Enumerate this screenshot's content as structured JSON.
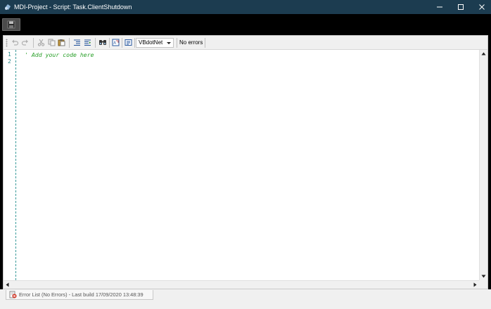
{
  "window": {
    "title": "MDI-Project - Script: Task.ClientShutdown",
    "icons": {
      "app": "app-icon",
      "minimize": "minimize-icon",
      "maximize": "maximize-icon",
      "close": "close-icon"
    }
  },
  "top_strip": {
    "save_icon": "floppy-save-icon"
  },
  "toolbar": {
    "icons": [
      "undo-icon",
      "redo-icon",
      "cut-icon",
      "copy-icon",
      "paste-icon",
      "indent-icon",
      "outdent-icon",
      "find-icon",
      "replace-icon",
      "properties-icon"
    ],
    "language": "VBdotNet",
    "status": "No errors"
  },
  "editor": {
    "line_numbers": [
      "1",
      "2"
    ],
    "lines": [
      "' Add your code here",
      ""
    ]
  },
  "bottom": {
    "tab_label": "Error List (No Errors) - Last build 17/09/2020 13:48:39",
    "tab_icon": "error-list-icon"
  },
  "colors": {
    "titlebar": "#1c3c50",
    "comment": "#2aa02a",
    "gutter_line": "#3a9a9a"
  }
}
